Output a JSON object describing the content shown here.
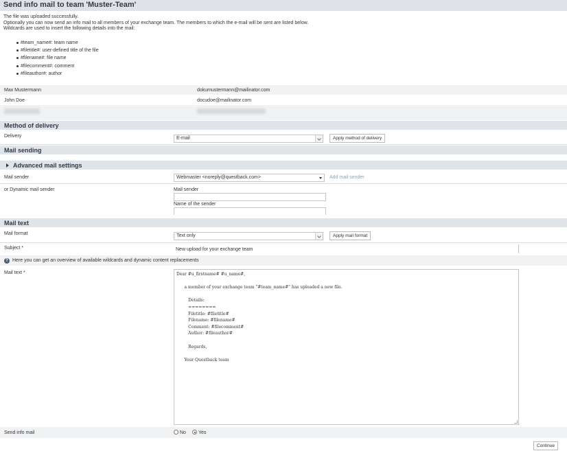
{
  "page": {
    "title": "Send info mail to team 'Muster-Team'",
    "intro_lines": [
      "The file was uploaded successfully.",
      "Optionally you can now send an info mail to all members of your exchange team. The members to which the e-mail will be sent are listed below.",
      "Wildcards are used to insert the following details into the mail:"
    ],
    "wildcards": [
      "#team_name#: team name",
      "#filetitle#: user-defined title of the file",
      "#filename#: file name",
      "#filecomment#: comment",
      "#fileauthor#: author"
    ]
  },
  "members": [
    {
      "name": "Max Mustermann",
      "email": "dokumustermann@mailinator.com"
    },
    {
      "name": "John Doe",
      "email": "docudoe@mailinator.com"
    }
  ],
  "delivery": {
    "section_title": "Method of delivery",
    "label": "Delivery",
    "selected": "E-mail",
    "apply_button": "Apply method of delivery"
  },
  "mail_sending": {
    "section_title": "Mail sending",
    "advanced_title": "Advanced mail settings",
    "sender_label": "Mail sender",
    "sender_selected": "Webmaster <noreply@questback.com>",
    "add_sender_link": "Add mail sender",
    "dynamic_label": "or Dynamic mail sender",
    "dynamic_sender_caption": "Mail sender",
    "dynamic_sender_value": "",
    "sender_name_caption": "Name of the sender",
    "sender_name_value": ""
  },
  "mail_text": {
    "section_title": "Mail text",
    "format_label": "Mail format",
    "format_selected": "Text only",
    "apply_format_button": "Apply mail format",
    "subject_label": "Subject *",
    "subject_value": "New upload for your exchange team",
    "info_text": "Here you can get an overview of available wildcards and dynamic content replacements",
    "body_label": "Mail text *",
    "body": "Dear #u_firstname# #u_name#,\n\n      a member of your exchange team \"#team_name#\" has uploaded a new file.\n\n         Details:\n         ========\n         Filetitle: #filetitle#\n         Filename: #filename#\n         Comment: #filecomment#\n         Author: #fileauthor#\n\n         Regards,\n\n      Your Questback team"
  },
  "send_info": {
    "label": "Send info mail",
    "option_no": "No",
    "option_yes": "Yes",
    "selected": "Yes"
  },
  "footer": {
    "continue_button": "Continue"
  }
}
